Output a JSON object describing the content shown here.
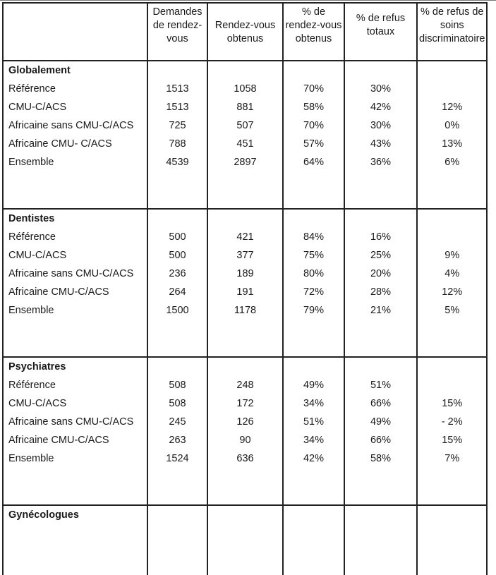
{
  "headers": [
    "",
    "Demandes de rendez-vous",
    "Rendez-vous obtenus",
    "% de rendez-vous obtenus",
    "% de refus totaux",
    "% de refus de soins discriminatoire"
  ],
  "header_lines": {
    "demandes": [
      "Demandes",
      "de rendez-",
      "vous"
    ],
    "obtenus": [
      "Rendez-vous",
      "obtenus"
    ],
    "pct_obtenus": [
      "% de",
      "rendez-vous",
      "obtenus"
    ],
    "refus_totaux": [
      "% de refus",
      "totaux"
    ],
    "refus_discr": [
      "% de refus de",
      "soins",
      "discriminatoire"
    ]
  },
  "sections": [
    {
      "title": "Globalement",
      "rows": [
        {
          "label": "Référence",
          "demandes": "1513",
          "obtenus": "1058",
          "pct_obtenus": "70%",
          "refus_totaux": "30%"
        },
        {
          "label": "CMU-C/ACS",
          "demandes": "1513",
          "obtenus": "881",
          "pct_obtenus": "58%",
          "refus_totaux": "42%"
        },
        {
          "label": "Africaine sans CMU-C/ACS",
          "demandes": "725",
          "obtenus": "507",
          "pct_obtenus": "70%",
          "refus_totaux": "30%"
        },
        {
          "label": "Africaine CMU- C/ACS",
          "demandes": "788",
          "obtenus": "451",
          "pct_obtenus": "57%",
          "refus_totaux": "43%"
        },
        {
          "label": "Ensemble",
          "demandes": "4539",
          "obtenus": "2897",
          "pct_obtenus": "64%",
          "refus_totaux": "36%"
        }
      ],
      "refus_discr": [
        "12%",
        "0%",
        "13%",
        "6%"
      ]
    },
    {
      "title": "Dentistes",
      "rows": [
        {
          "label": "Référence",
          "demandes": "500",
          "obtenus": "421",
          "pct_obtenus": "84%",
          "refus_totaux": "16%"
        },
        {
          "label": "CMU-C/ACS",
          "demandes": "500",
          "obtenus": "377",
          "pct_obtenus": "75%",
          "refus_totaux": "25%"
        },
        {
          "label": "Africaine sans CMU-C/ACS",
          "demandes": "236",
          "obtenus": "189",
          "pct_obtenus": "80%",
          "refus_totaux": "20%"
        },
        {
          "label": "Africaine CMU-C/ACS",
          "demandes": "264",
          "obtenus": "191",
          "pct_obtenus": "72%",
          "refus_totaux": "28%"
        },
        {
          "label": "Ensemble",
          "demandes": "1500",
          "obtenus": "1178",
          "pct_obtenus": "79%",
          "refus_totaux": "21%"
        }
      ],
      "refus_discr": [
        "9%",
        "4%",
        "12%",
        "5%"
      ]
    },
    {
      "title": "Psychiatres",
      "rows": [
        {
          "label": "Référence",
          "demandes": "508",
          "obtenus": "248",
          "pct_obtenus": "49%",
          "refus_totaux": "51%"
        },
        {
          "label": "CMU-C/ACS",
          "demandes": "508",
          "obtenus": "172",
          "pct_obtenus": "34%",
          "refus_totaux": "66%"
        },
        {
          "label": "Africaine sans CMU-C/ACS",
          "demandes": "245",
          "obtenus": "126",
          "pct_obtenus": "51%",
          "refus_totaux": "49%"
        },
        {
          "label": "Africaine CMU-C/ACS",
          "demandes": "263",
          "obtenus": "90",
          "pct_obtenus": "34%",
          "refus_totaux": "66%"
        },
        {
          "label": "Ensemble",
          "demandes": "1524",
          "obtenus": "636",
          "pct_obtenus": "42%",
          "refus_totaux": "58%"
        }
      ],
      "refus_discr": [
        "15%",
        "- 2%",
        "15%",
        "7%"
      ]
    },
    {
      "title": "Gynécologues",
      "rows": [],
      "refus_discr": []
    }
  ]
}
